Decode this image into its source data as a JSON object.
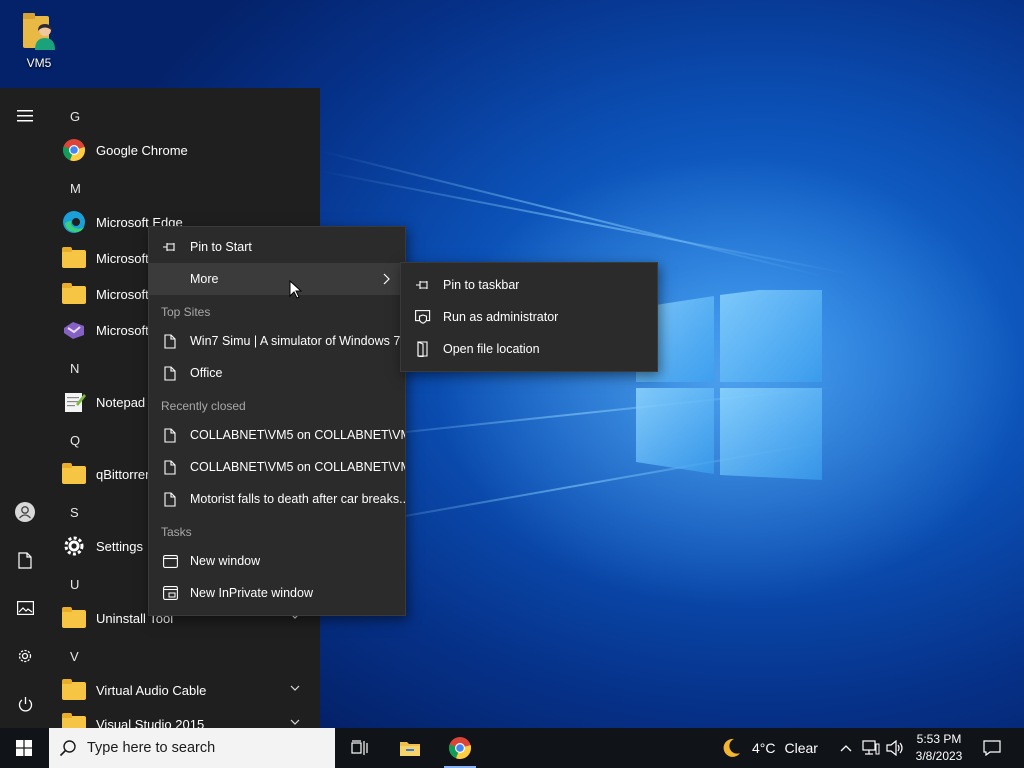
{
  "desktop": {
    "icon_label": "VM5"
  },
  "start_menu": {
    "sections": [
      {
        "letter": "G",
        "apps": [
          {
            "label": "Google Chrome",
            "icon": "chrome-icon"
          }
        ]
      },
      {
        "letter": "M",
        "apps": [
          {
            "label": "Microsoft Edge",
            "icon": "edge-icon"
          },
          {
            "label": "Microsoft",
            "icon": "folder-icon"
          },
          {
            "label": "Microsoft",
            "icon": "folder-icon"
          },
          {
            "label": "Microsoft",
            "icon": "visual-studio-icon"
          }
        ]
      },
      {
        "letter": "N",
        "apps": [
          {
            "label": "Notepad",
            "icon": "notepad-plus-plus-icon"
          }
        ]
      },
      {
        "letter": "Q",
        "apps": [
          {
            "label": "qBittorrent",
            "icon": "folder-icon"
          }
        ]
      },
      {
        "letter": "S",
        "apps": [
          {
            "label": "Settings",
            "icon": "gear-icon"
          }
        ]
      },
      {
        "letter": "U",
        "apps": [
          {
            "label": "Uninstall Tool",
            "icon": "folder-icon"
          }
        ]
      },
      {
        "letter": "V",
        "apps": [
          {
            "label": "Virtual Audio Cable",
            "icon": "folder-icon"
          },
          {
            "label": "Visual Studio 2015",
            "icon": "folder-icon"
          }
        ]
      }
    ]
  },
  "context_menu": {
    "pin_to_start": "Pin to Start",
    "more": "More",
    "top_sites_header": "Top Sites",
    "top_sites": [
      "Win7 Simu | A simulator of Windows 7",
      "Office"
    ],
    "recently_closed_header": "Recently closed",
    "recently_closed": [
      "COLLABNET\\VM5 on COLLABNET\\VM5",
      "COLLABNET\\VM5 on COLLABNET\\VM5",
      "Motorist falls to death after car breaks..."
    ],
    "tasks_header": "Tasks",
    "tasks": [
      "New window",
      "New InPrivate window"
    ]
  },
  "submenu": {
    "pin_to_taskbar": "Pin to taskbar",
    "run_as_admin": "Run as administrator",
    "open_file_location": "Open file location"
  },
  "taskbar": {
    "search_placeholder": "Type here to search",
    "weather_temp": "4°C",
    "weather_text": "Clear",
    "time": "5:53 PM",
    "date": "3/8/2023"
  }
}
